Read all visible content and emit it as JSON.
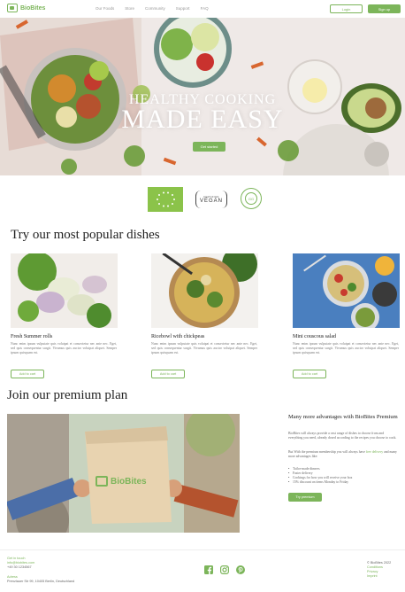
{
  "header": {
    "logo_text": "BioBites",
    "nav": [
      "Our Foods",
      "Store",
      "Community",
      "Support",
      "FAQ"
    ],
    "login_label": "Login",
    "signup_label": "Sign up"
  },
  "hero": {
    "title_line1": "HEALTHY COOKING",
    "title_line2": "MADE EASY",
    "cta_label": "Get started"
  },
  "badges": {
    "vegan_small": "CERTIFIED",
    "vegan_big": "VEGAN",
    "circle_text": "GG"
  },
  "popular": {
    "title": "Try our most popular dishes",
    "dishes": [
      {
        "name": "Fresh Summer rolls",
        "description": "Nunc enim ipsum vulputate quis volutpat et consectetur nec ante nec. Eget, sed quis consequentur surgit. Vivamus quis auctor volutpat aliquet. Semper ipsum quisquam est.",
        "button": "Add to cart"
      },
      {
        "name": "Ricebowl with chickpeas",
        "description": "Nunc enim ipsum vulputate quis volutpat et consectetur nec ante nec. Eget, sed quis consequentur surgit. Vivamus quis auctor volutpat aliquet. Semper ipsum quisquam est.",
        "button": "Add to cart"
      },
      {
        "name": "Mini couscous salad",
        "description": "Nunc enim ipsum vulputate quis volutpat et consectetur nec ante nec. Eget, sed quis consequentur surgit. Vivamus quis auctor volutpat aliquet. Semper ipsum quisquam est.",
        "button": "Add to cart"
      }
    ]
  },
  "premium": {
    "title": "Join our premium plan",
    "image_brand": "BioBites",
    "heading": "Many more advantages with BioBites Premium",
    "paragraph1": "BioBites will always provide a vast range of dishes to choose from and everything you need, already dosed according to the recipes you choose to cook.",
    "paragraph2_prefix": "But With the premium membership you will always have",
    "paragraph2_link": "free delivery",
    "paragraph2_suffix": "and many more advantages like:",
    "benefits": [
      "Tailor-made dinners",
      "Faster delivery",
      "Cookings for how you will receive your box",
      "15% discount on items Monday to Friday"
    ],
    "cta_label": "Try premium"
  },
  "footer": {
    "contact_label": "Get in touch",
    "email": "info@biobites.com",
    "phone": "+49 30 1234567",
    "address_label": "Adress",
    "address": "Prenzlauer Str 99, 10405 Berlin, Deutschland",
    "links": [
      "© BioBites 2022",
      "Conditions",
      "Privacy",
      "Imprint"
    ],
    "social_icons": [
      "facebook-icon",
      "instagram-icon",
      "pinterest-icon"
    ]
  },
  "colors": {
    "accent": "#7cb55a"
  }
}
